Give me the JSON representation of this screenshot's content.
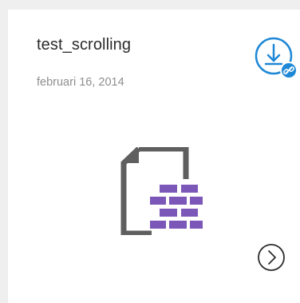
{
  "card": {
    "title": "test_scrolling",
    "date": "februari 16, 2014",
    "icons": {
      "download": "download-link-icon",
      "file": "database-file-icon",
      "next": "chevron-right-circle-icon"
    },
    "colors": {
      "accent": "#1f88d6",
      "file_outline": "#5f5f5f",
      "bricks": "#7b57b8"
    }
  }
}
